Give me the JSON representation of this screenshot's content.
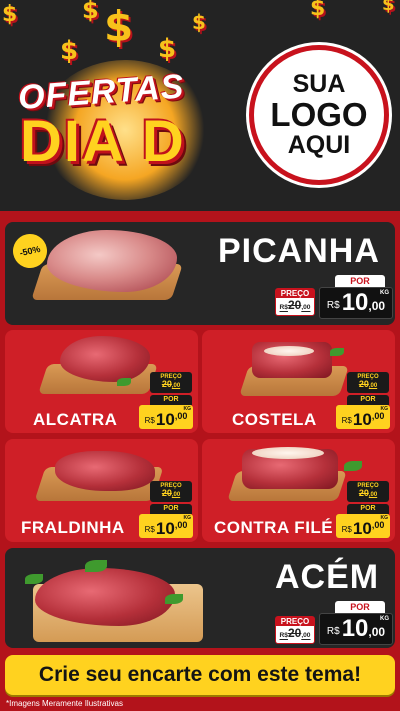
{
  "header": {
    "title_top": "OFERTAS",
    "title_bottom": "DIA D",
    "logo": {
      "line1": "SUA",
      "line2": "LOGO",
      "line3": "AQUI"
    },
    "dollar_glyph": "$"
  },
  "labels": {
    "preco": "PREÇO",
    "por": "POR",
    "currency": "R$",
    "kg": "KG"
  },
  "products": {
    "picanha": {
      "name": "PICANHA",
      "discount": "-50%",
      "old_price": "20",
      "old_cents": ",00",
      "price": "10",
      "cents": ",00"
    },
    "alcatra": {
      "name": "ALCATRA",
      "old_price": "20",
      "old_cents": ",00",
      "price": "10",
      "cents": ",00"
    },
    "costela": {
      "name": "COSTELA",
      "old_price": "20",
      "old_cents": ",00",
      "price": "10",
      "cents": ",00"
    },
    "fraldinha": {
      "name": "FRALDINHA",
      "old_price": "20",
      "old_cents": ",00",
      "price": "10",
      "cents": ",00"
    },
    "contra_file": {
      "name": "CONTRA FILÉ",
      "old_price": "20",
      "old_cents": ",00",
      "price": "10",
      "cents": ",00"
    },
    "acem": {
      "name": "ACÉM",
      "old_price": "20",
      "old_cents": ",00",
      "price": "10",
      "cents": ",00"
    }
  },
  "banner": {
    "text": "Crie seu encarte com este tema!"
  },
  "disclaimer": "*Imagens Meramente Ilustrativas",
  "colors": {
    "red": "#cf1f27",
    "dark": "#262626",
    "yellow": "#ffd21f",
    "brand_red": "#c8121d"
  }
}
